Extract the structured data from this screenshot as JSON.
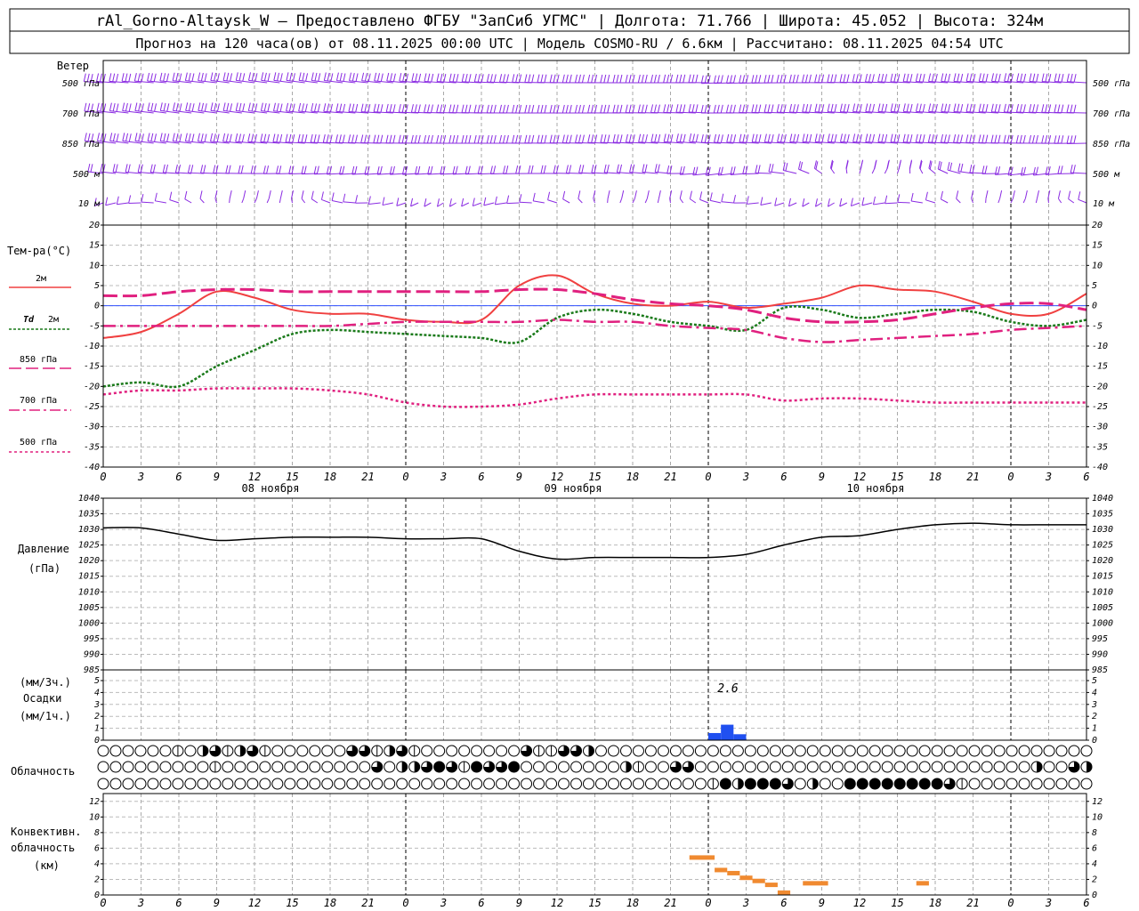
{
  "header": {
    "line1": "rAl_Gorno-Altaysk_W — Предоставлено ФГБУ \"ЗапСиб УГМС\" | Долгота: 71.766 | Широта: 45.052 | Высота: 324м",
    "line2": "Прогноз на 120 часа(ов) от 08.11.2025 00:00 UTC  | Модель COSMO-RU / 6.6км | Рассчитано: 08.11.2025 04:54 UTC"
  },
  "chart_data": [
    {
      "type": "line",
      "panel": "wind",
      "ylabel": "Ветер",
      "levels": [
        "500 гПа",
        "700 гПа",
        "850 гПа",
        "500 м",
        "10 м"
      ],
      "colors": {
        "barb": "#8a2be2"
      }
    },
    {
      "type": "line",
      "panel": "temperature",
      "ylabel": "Тем-ра(°C)",
      "ylim": [
        -40,
        20
      ],
      "yticks": [
        20,
        15,
        10,
        5,
        0,
        -5,
        -10,
        -15,
        -20,
        -25,
        -30,
        -35,
        -40
      ],
      "x": [
        0,
        3,
        6,
        9,
        12,
        15,
        18,
        21,
        24,
        27,
        30,
        33,
        36,
        39,
        42,
        45,
        48,
        51,
        54,
        57,
        60,
        63,
        66,
        69,
        72,
        75,
        78
      ],
      "series": [
        {
          "name": "2м",
          "color": "#f04040",
          "values": [
            -8,
            -6.5,
            -2,
            3.5,
            2,
            -1,
            -2,
            -2,
            -3.5,
            -4,
            -3.5,
            5,
            7.5,
            3,
            0.5,
            0,
            1,
            -0.5,
            0.5,
            2,
            5,
            4,
            3.5,
            1,
            -2,
            -2,
            3
          ]
        },
        {
          "name": "Td 2м",
          "color": "#1a7a1a",
          "values": [
            -20,
            -19,
            -20,
            -15,
            -11,
            -7,
            -6,
            -6.5,
            -7,
            -7.5,
            -8,
            -9,
            -3,
            -1,
            -2,
            -4,
            -5,
            -6,
            -0.5,
            -1,
            -3,
            -2,
            -1,
            -1.5,
            -4,
            -5,
            -3.5
          ]
        },
        {
          "name": "850 гПа",
          "color": "#e0207f",
          "values": [
            2.5,
            2.5,
            3.5,
            4,
            4,
            3.5,
            3.5,
            3.5,
            3.5,
            3.5,
            3.5,
            4,
            4,
            3,
            1.5,
            0.5,
            0,
            -1,
            -3,
            -4,
            -4,
            -3.5,
            -2,
            -0.5,
            0.5,
            0.5,
            -1
          ]
        },
        {
          "name": "700 гПа",
          "color": "#e0207f",
          "values": [
            -5,
            -5,
            -5,
            -5,
            -5,
            -5,
            -5,
            -4.5,
            -4,
            -4,
            -4,
            -4,
            -3.5,
            -4,
            -4,
            -5,
            -5.5,
            -6,
            -8,
            -9,
            -8.5,
            -8,
            -7.5,
            -7,
            -6,
            -5.5,
            -5
          ]
        },
        {
          "name": "500 гПа",
          "color": "#e0207f",
          "values": [
            -22,
            -21,
            -21,
            -20.5,
            -20.5,
            -20.5,
            -21,
            -22,
            -24,
            -25,
            -25,
            -24.5,
            -23,
            -22,
            -22,
            -22,
            -22,
            -22,
            -23.5,
            -23,
            -23,
            -23.5,
            -24,
            -24,
            -24,
            -24,
            -24
          ]
        }
      ]
    },
    {
      "type": "line",
      "panel": "pressure",
      "ylabel": "Давление",
      "ylabel2": "(гПа)",
      "ylim": [
        985,
        1040
      ],
      "yticks": [
        1040,
        1035,
        1030,
        1025,
        1020,
        1015,
        1010,
        1005,
        1000,
        995,
        990,
        985
      ],
      "x": [
        0,
        3,
        6,
        9,
        12,
        15,
        18,
        21,
        24,
        27,
        30,
        33,
        36,
        39,
        42,
        45,
        48,
        51,
        54,
        57,
        60,
        63,
        66,
        69,
        72,
        75,
        78
      ],
      "series": [
        {
          "name": "pressure",
          "color": "#000000",
          "values": [
            1030.5,
            1030.5,
            1028.5,
            1026.5,
            1027,
            1027.5,
            1027.5,
            1027.5,
            1027,
            1027,
            1027,
            1023,
            1020.5,
            1021,
            1021,
            1021,
            1021,
            1022,
            1025,
            1027.5,
            1028,
            1030,
            1031.5,
            1032,
            1031.5,
            1031.5,
            1031.5
          ]
        }
      ]
    },
    {
      "type": "bar",
      "panel": "precipitation",
      "ylabel_top": "(мм/3ч.)",
      "ylabel": "Осадки",
      "ylabel_bottom": "(мм/1ч.)",
      "ylim": [
        0,
        5
      ],
      "yticks": [
        5,
        4,
        3,
        2,
        1,
        0
      ],
      "annotation": "2.6",
      "color": "#2050f0",
      "bars": [
        {
          "x": 48.5,
          "value": 0.6
        },
        {
          "x": 49.5,
          "value": 1.3
        },
        {
          "x": 50.5,
          "value": 0.5
        }
      ]
    },
    {
      "type": "table",
      "panel": "clouds",
      "ylabel": "Облачность",
      "rows": [
        [
          0,
          0,
          0,
          0,
          0,
          0,
          1,
          0,
          2,
          3,
          1,
          2,
          3,
          1,
          0,
          0,
          0,
          0,
          0,
          0,
          3,
          3,
          1,
          2,
          3,
          1,
          0,
          0,
          0,
          0,
          0,
          0,
          0,
          0,
          3,
          1,
          1,
          3,
          3,
          2,
          0,
          0,
          0,
          0,
          0,
          0,
          0,
          0,
          0,
          0,
          0,
          0,
          0,
          0,
          0,
          0,
          0,
          0,
          0,
          0,
          0,
          0,
          0,
          0,
          0,
          0,
          0,
          0,
          0,
          0,
          0,
          0,
          0,
          0,
          0,
          0,
          0,
          0,
          0,
          0
        ],
        [
          0,
          0,
          0,
          0,
          0,
          0,
          0,
          0,
          0,
          1,
          0,
          0,
          0,
          0,
          0,
          0,
          0,
          0,
          0,
          0,
          0,
          0,
          3,
          0,
          2,
          2,
          3,
          4,
          3,
          1,
          4,
          3,
          3,
          4,
          0,
          0,
          0,
          0,
          0,
          0,
          0,
          0,
          2,
          1,
          0,
          0,
          3,
          3,
          0,
          0,
          0,
          0,
          0,
          0,
          0,
          0,
          0,
          0,
          0,
          0,
          0,
          0,
          0,
          0,
          0,
          0,
          0,
          0,
          0,
          0,
          0,
          0,
          0,
          0,
          0,
          2,
          0,
          0,
          3,
          2
        ],
        [
          0,
          0,
          0,
          0,
          0,
          0,
          0,
          0,
          0,
          0,
          0,
          0,
          0,
          0,
          0,
          0,
          0,
          0,
          0,
          0,
          0,
          0,
          0,
          0,
          0,
          0,
          0,
          0,
          0,
          0,
          0,
          0,
          0,
          0,
          0,
          0,
          0,
          0,
          0,
          0,
          0,
          0,
          0,
          0,
          0,
          0,
          0,
          0,
          0,
          1,
          4,
          2,
          4,
          4,
          4,
          3,
          0,
          2,
          0,
          0,
          4,
          4,
          4,
          4,
          4,
          4,
          4,
          4,
          3,
          1,
          0,
          0,
          0,
          0,
          0,
          0,
          0,
          0,
          0,
          0
        ]
      ],
      "legend": {
        "0": "clear",
        "1": "1/4",
        "2": "1/2",
        "3": "3/4",
        "4": "overcast"
      }
    },
    {
      "type": "bar",
      "panel": "convective",
      "ylabel": "Конвективн.",
      "ylabel2": "облачность",
      "ylabel3": "(км)",
      "ylim": [
        0,
        13
      ],
      "yticks": [
        12,
        10,
        8,
        6,
        4,
        2,
        0
      ],
      "color": "#f08a30",
      "segments": [
        {
          "x0": 46.5,
          "x1": 48.5,
          "value": 4.8
        },
        {
          "x0": 48.5,
          "x1": 49.5,
          "value": 3.2
        },
        {
          "x0": 49.5,
          "x1": 50.5,
          "value": 2.8
        },
        {
          "x0": 50.5,
          "x1": 51.5,
          "value": 2.2
        },
        {
          "x0": 51.5,
          "x1": 52.5,
          "value": 1.8
        },
        {
          "x0": 52.5,
          "x1": 53.5,
          "value": 1.3
        },
        {
          "x0": 53.5,
          "x1": 54.5,
          "value": 0.3
        },
        {
          "x0": 55.5,
          "x1": 57.5,
          "value": 1.5
        },
        {
          "x0": 64.5,
          "x1": 65.5,
          "value": 1.5
        }
      ]
    }
  ],
  "xaxis": {
    "ticks": [
      "0",
      "3",
      "6",
      "9",
      "12",
      "15",
      "18",
      "21",
      "0",
      "3",
      "6",
      "9",
      "12",
      "15",
      "18",
      "21",
      "0",
      "3",
      "6",
      "9",
      "12",
      "15",
      "18",
      "21",
      "0",
      "3",
      "6"
    ],
    "days": [
      "08 ноября",
      "09 ноября",
      "10 ноября"
    ]
  },
  "legend_labels": {
    "t2m": "2м",
    "td_t": "Td",
    "td_2m": "2м",
    "t850": "850 гПа",
    "t700": "700 гПа",
    "t500": "500 гПа"
  }
}
